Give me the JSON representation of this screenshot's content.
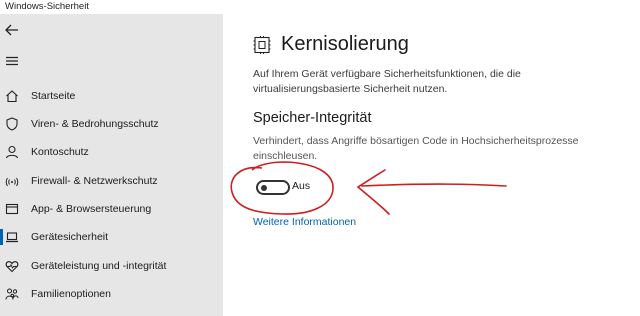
{
  "window": {
    "title": "Windows-Sicherheit"
  },
  "sidebar": {
    "items": [
      {
        "label": "Startseite",
        "icon": "home-icon"
      },
      {
        "label": "Viren- & Bedrohungsschutz",
        "icon": "shield-icon"
      },
      {
        "label": "Kontoschutz",
        "icon": "person-icon"
      },
      {
        "label": "Firewall- & Netzwerkschutz",
        "icon": "wifi-icon"
      },
      {
        "label": "App- & Browsersteuerung",
        "icon": "app-window-icon"
      },
      {
        "label": "Gerätesicherheit",
        "icon": "laptop-icon",
        "selected": true
      },
      {
        "label": "Geräteleistung und -integrität",
        "icon": "heart-icon"
      },
      {
        "label": "Familienoptionen",
        "icon": "family-icon"
      }
    ]
  },
  "main": {
    "title": "Kernisolierung",
    "description": "Auf Ihrem Gerät verfügbare Sicherheitsfunktionen, die die virtualisierungsbasierte Sicherheit nutzen.",
    "section": {
      "title": "Speicher-Integrität",
      "description": "Verhindert, dass Angriffe bösartigen Code in Hochsicherheitsprozesse einschleusen.",
      "toggle": {
        "state": "off",
        "label": "Aus"
      },
      "link": "Weitere Informationen"
    }
  },
  "colors": {
    "accent": "#0063b1",
    "sidebar_bg": "#e6e6e6",
    "annotation": "#cc1f1f"
  }
}
